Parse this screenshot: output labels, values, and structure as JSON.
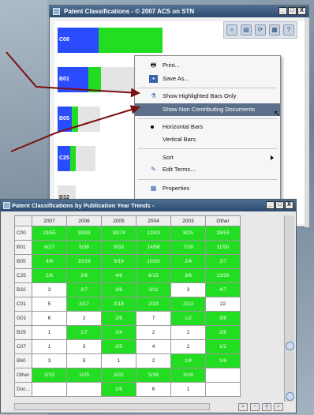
{
  "window1": {
    "title": "Patent Classifications - © 2007 ACS on STN",
    "controls": [
      "_",
      "□",
      "X"
    ],
    "bars": [
      {
        "label": "C08",
        "blue": 45,
        "green": 70,
        "gray": 0
      },
      {
        "label": "B01",
        "blue": 34,
        "green": 14,
        "gray": 40
      },
      {
        "label": "B05",
        "blue": 16,
        "green": 7,
        "gray": 24
      },
      {
        "label": "C25",
        "blue": 14,
        "green": 6,
        "gray": 22
      },
      {
        "label": "B32",
        "blue": 0,
        "green": 0,
        "gray": 20
      }
    ]
  },
  "menu": {
    "items": [
      {
        "label": "Print...",
        "icon": "printer-icon"
      },
      {
        "label": "Save As...",
        "icon": "save-icon"
      },
      {
        "label": "Show Highlighted Bars Only",
        "icon": "filter-icon"
      },
      {
        "label": "Show Non Contributing Documents",
        "icon": ""
      },
      {
        "label": "Horizontal Bars",
        "icon": "radio-dot"
      },
      {
        "label": "Vertical Bars",
        "icon": ""
      },
      {
        "label": "Sort",
        "icon": ""
      },
      {
        "label": "Edit Terms...",
        "icon": "edit-icon"
      },
      {
        "label": "Properties",
        "icon": "properties-icon"
      }
    ],
    "highlighted_index": 3
  },
  "window2": {
    "title": "Patent Classifications by Publication Year Trends -",
    "columns": [
      "",
      "2007",
      "2006",
      "2005",
      "2004",
      "2003",
      "Other"
    ],
    "rows": [
      {
        "label": "C00",
        "cells": [
          "23/55",
          "30/93",
          "30/74",
          "12/43",
          "8/25",
          "28/53"
        ],
        "green": [
          1,
          1,
          1,
          1,
          1,
          1
        ]
      },
      {
        "label": "B01",
        "cells": [
          "6/27",
          "5/38",
          "9/33",
          "14/58",
          "7/28",
          "11/50"
        ],
        "green": [
          1,
          1,
          1,
          1,
          1,
          1
        ]
      },
      {
        "label": "B05",
        "cells": [
          "4/9",
          "10/19",
          "9/19",
          "10/20",
          "2/4",
          "2/7"
        ],
        "green": [
          1,
          1,
          1,
          1,
          1,
          1
        ]
      },
      {
        "label": "C25",
        "cells": [
          "2/6",
          "2/6",
          "4/6",
          "6/15",
          "3/6",
          "13/20"
        ],
        "green": [
          1,
          1,
          1,
          1,
          1,
          1
        ]
      },
      {
        "label": "B32",
        "cells": [
          "3",
          "2/7",
          "3/8",
          "3/11",
          "3",
          "4/7"
        ],
        "green": [
          0,
          1,
          1,
          1,
          0,
          1
        ]
      },
      {
        "label": "C01",
        "cells": [
          "5",
          "2/17",
          "3/18",
          "2/33",
          "2/13",
          "22"
        ],
        "green": [
          0,
          1,
          1,
          1,
          1,
          0
        ]
      },
      {
        "label": "G01",
        "cells": [
          "6",
          "2",
          "2/6",
          "7",
          "1/2",
          "3/8"
        ],
        "green": [
          0,
          0,
          1,
          0,
          1,
          1
        ]
      },
      {
        "label": "B29",
        "cells": [
          "1",
          "1/7",
          "1/4",
          "2",
          "2",
          "2/6"
        ],
        "green": [
          0,
          1,
          1,
          0,
          0,
          1
        ]
      },
      {
        "label": "C07",
        "cells": [
          "1",
          "3",
          "2/5",
          "4",
          "2",
          "1/2"
        ],
        "green": [
          0,
          0,
          1,
          0,
          0,
          1
        ]
      },
      {
        "label": "B60",
        "cells": [
          "3",
          "5",
          "1",
          "2",
          "1/4",
          "1/6"
        ],
        "green": [
          0,
          0,
          0,
          0,
          1,
          1
        ]
      },
      {
        "label": "Other",
        "cells": [
          "2/15",
          "1/25",
          "3/31",
          "5/39",
          "3/18",
          ""
        ],
        "green": [
          1,
          1,
          1,
          1,
          1,
          0
        ]
      },
      {
        "label": "Doc...",
        "cells": [
          "",
          "",
          "1/6",
          "6",
          "1",
          ""
        ],
        "green": [
          0,
          0,
          1,
          0,
          0,
          0
        ]
      }
    ]
  }
}
